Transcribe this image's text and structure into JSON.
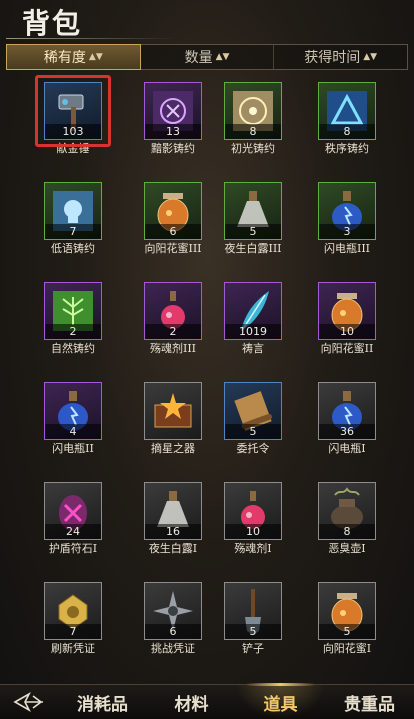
{
  "header": {
    "title": "背包"
  },
  "sort_tabs": [
    {
      "label": "稀有度",
      "arrow": "▲▼",
      "active": true
    },
    {
      "label": "数量",
      "arrow": "▲▼",
      "active": false
    },
    {
      "label": "获得时间",
      "arrow": "▲▼",
      "active": false
    }
  ],
  "items": [
    {
      "name": "献金锤",
      "qty": "103",
      "rarity": "blue",
      "icon": "hammer-icon",
      "selected": true
    },
    {
      "name": "黯影铸约",
      "qty": "13",
      "rarity": "purple",
      "icon": "shadow-rune-icon"
    },
    {
      "name": "初光铸约",
      "qty": "8",
      "rarity": "green",
      "icon": "light-rune-icon"
    },
    {
      "name": "秩序铸约",
      "qty": "8",
      "rarity": "green",
      "icon": "order-rune-icon"
    },
    {
      "name": "低语铸约",
      "qty": "7",
      "rarity": "green",
      "icon": "whisper-rune-icon"
    },
    {
      "name": "向阳花蜜III",
      "qty": "6",
      "rarity": "green",
      "icon": "honey-jar-icon"
    },
    {
      "name": "夜生白露III",
      "qty": "5",
      "rarity": "green",
      "icon": "white-dew-flask-icon"
    },
    {
      "name": "闪电瓶III",
      "qty": "3",
      "rarity": "green",
      "icon": "lightning-bottle-icon"
    },
    {
      "name": "自然铸约",
      "qty": "2",
      "rarity": "purple",
      "icon": "nature-rune-icon"
    },
    {
      "name": "殇魂剂III",
      "qty": "2",
      "rarity": "purple",
      "icon": "soul-potion-icon"
    },
    {
      "name": "祷言",
      "qty": "1019",
      "rarity": "purple",
      "icon": "prayer-feather-icon"
    },
    {
      "name": "向阳花蜜II",
      "qty": "10",
      "rarity": "purple",
      "icon": "honey-jar-icon"
    },
    {
      "name": "闪电瓶II",
      "qty": "4",
      "rarity": "purple",
      "icon": "lightning-bottle-icon"
    },
    {
      "name": "摘星之器",
      "qty": "",
      "rarity": "gray",
      "icon": "star-box-icon"
    },
    {
      "name": "委托令",
      "qty": "5",
      "rarity": "blue",
      "icon": "scroll-icon"
    },
    {
      "name": "闪电瓶I",
      "qty": "36",
      "rarity": "gray",
      "icon": "lightning-bottle-icon"
    },
    {
      "name": "护盾符石I",
      "qty": "24",
      "rarity": "gray",
      "icon": "shield-runestone-icon"
    },
    {
      "name": "夜生白露I",
      "qty": "16",
      "rarity": "gray",
      "icon": "white-dew-flask-icon"
    },
    {
      "name": "殇魂剂I",
      "qty": "10",
      "rarity": "gray",
      "icon": "soul-potion-icon"
    },
    {
      "name": "恶臭壶I",
      "qty": "8",
      "rarity": "gray",
      "icon": "stench-pot-icon"
    },
    {
      "name": "刷新凭证",
      "qty": "7",
      "rarity": "gray",
      "icon": "refresh-token-icon"
    },
    {
      "name": "挑战凭证",
      "qty": "6",
      "rarity": "gray",
      "icon": "challenge-token-icon"
    },
    {
      "name": "铲子",
      "qty": "5",
      "rarity": "gray",
      "icon": "shovel-icon"
    },
    {
      "name": "向阳花蜜I",
      "qty": "5",
      "rarity": "gray",
      "icon": "honey-jar-icon"
    }
  ],
  "bottom_nav": {
    "back_icon": "back-arrow-icon",
    "tabs": [
      {
        "label": "消耗品",
        "active": false
      },
      {
        "label": "材料",
        "active": false
      },
      {
        "label": "道具",
        "active": true
      },
      {
        "label": "贵重品",
        "active": false
      }
    ]
  },
  "colors": {
    "accent": "#f3c76a",
    "selected_outline": "#d9332f",
    "rarity_green": "#5fae3e",
    "rarity_blue": "#4f84c9",
    "rarity_purple": "#a35ad6",
    "rarity_gray": "#8d8d8d"
  }
}
